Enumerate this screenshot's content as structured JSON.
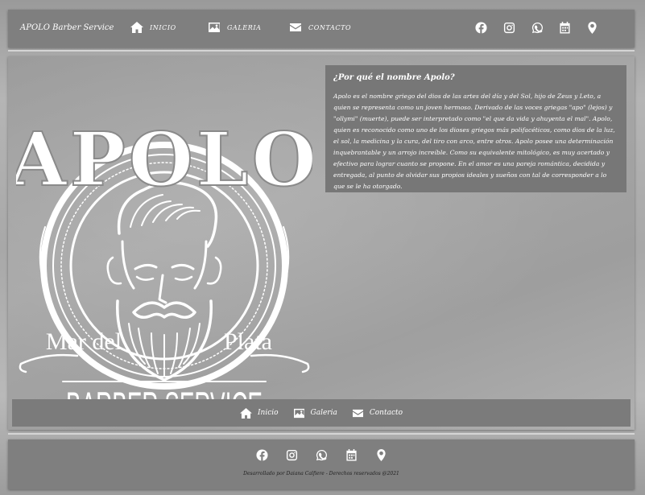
{
  "navbar": {
    "brand": "APOLO Barber Service",
    "links": [
      {
        "label": "INICIO",
        "icon": "home-icon"
      },
      {
        "label": "GALERIA",
        "icon": "image-icon"
      },
      {
        "label": "CONTACTO",
        "icon": "envelope-icon"
      }
    ],
    "social_icons": [
      "facebook-icon",
      "instagram-icon",
      "whatsapp-icon",
      "calendar-icon",
      "map-pin-icon"
    ]
  },
  "logo": {
    "top_word": "APOLO",
    "location_left": "Mar del",
    "location_right": "Plata",
    "bottom_text": "BARBER SERVICE"
  },
  "about": {
    "title": "¿Por qué el nombre Apolo?",
    "body": "Apolo es el nombre griego del dios de las artes del día y del Sol, hijo de Zeus y Leto, a quien se representa como un joven hermoso. Derivado de las voces griegas \"apo\" (lejos) y \"ollymi\" (muerte), puede ser interpretado como \"el que da vida y ahuyenta el mal\". Apolo, quien es reconocido como uno de los dioses griegos más polifacéticos, como dios de la luz, el sol, la medicina y la cura, del tiro con arco, entre otros. Apolo posee una determinación inquebrantable y un arrojo increíble. Como su equivalente mitológico, es muy acertado y efectivo para lograr cuanto se propone. En el amor es una pareja romántica, decidida y entregada, al punto de olvidar sus propios ideales y sueños con tal de corresponder a lo que se le ha otorgado."
  },
  "bottom_nav": {
    "links": [
      {
        "label": "Inicio",
        "icon": "home-icon"
      },
      {
        "label": "Galeria",
        "icon": "image-icon"
      },
      {
        "label": "Contacto",
        "icon": "envelope-icon"
      }
    ]
  },
  "footer": {
    "copyright": "Desarrollado por Daiana Calfiere - Derechos reservados @2021"
  },
  "colors": {
    "panel": "#7f7f7f",
    "about_panel": "#777777",
    "text": "#ffffff"
  }
}
